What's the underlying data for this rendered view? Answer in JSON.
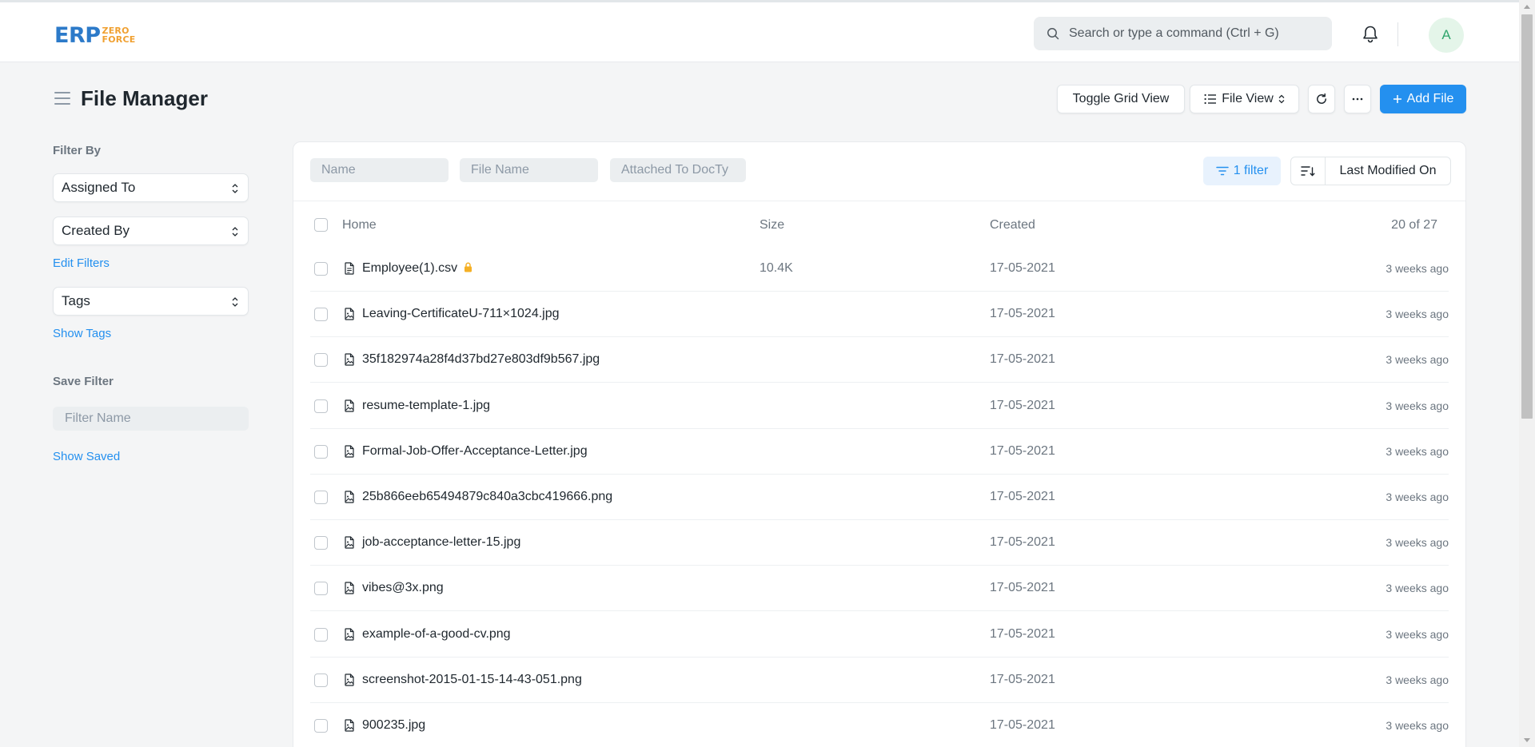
{
  "app": {
    "logo_main": "ERP",
    "logo_top": "ZERO",
    "logo_bottom": "FORCE"
  },
  "navbar": {
    "search_placeholder": "Search or type a command (Ctrl + G)",
    "avatar_initial": "A"
  },
  "page": {
    "title": "File Manager"
  },
  "toolbar": {
    "toggle_grid_label": "Toggle Grid View",
    "file_view_label": "File View",
    "add_file_label": "Add File"
  },
  "sidebar": {
    "filter_by_label": "Filter By",
    "assigned_to_label": "Assigned To",
    "created_by_label": "Created By",
    "edit_filters_label": "Edit Filters",
    "tags_label": "Tags",
    "show_tags_label": "Show Tags",
    "save_filter_label": "Save Filter",
    "filter_name_placeholder": "Filter Name",
    "show_saved_label": "Show Saved"
  },
  "list": {
    "filters": {
      "name_placeholder": "Name",
      "file_name_placeholder": "File Name",
      "attached_to_placeholder": "Attached To DocTy"
    },
    "filter_button_label": "1 filter",
    "sort_label": "Last Modified On",
    "columns": {
      "name": "Home",
      "size": "Size",
      "created": "Created",
      "count": "20 of 27"
    },
    "rows": [
      {
        "name": "Employee(1).csv",
        "size": "10.4K",
        "created": "17-05-2021",
        "modified": "3 weeks ago"
      },
      {
        "name": "Leaving-CertificateU-711×1024.jpg",
        "size": "",
        "created": "17-05-2021",
        "modified": "3 weeks ago"
      },
      {
        "name": "35f182974a28f4d37bd27e803df9b567.jpg",
        "size": "",
        "created": "17-05-2021",
        "modified": "3 weeks ago"
      },
      {
        "name": "resume-template-1.jpg",
        "size": "",
        "created": "17-05-2021",
        "modified": "3 weeks ago"
      },
      {
        "name": "Formal-Job-Offer-Acceptance-Letter.jpg",
        "size": "",
        "created": "17-05-2021",
        "modified": "3 weeks ago"
      },
      {
        "name": "25b866eeb65494879c840a3cbc419666.png",
        "size": "",
        "created": "17-05-2021",
        "modified": "3 weeks ago"
      },
      {
        "name": "job-acceptance-letter-15.jpg",
        "size": "",
        "created": "17-05-2021",
        "modified": "3 weeks ago"
      },
      {
        "name": "vibes@3x.png",
        "size": "",
        "created": "17-05-2021",
        "modified": "3 weeks ago"
      },
      {
        "name": "example-of-a-good-cv.png",
        "size": "",
        "created": "17-05-2021",
        "modified": "3 weeks ago"
      },
      {
        "name": "screenshot-2015-01-15-14-43-051.png",
        "size": "",
        "created": "17-05-2021",
        "modified": "3 weeks ago"
      },
      {
        "name": "900235.jpg",
        "size": "",
        "created": "17-05-2021",
        "modified": "3 weeks ago"
      }
    ]
  },
  "colors": {
    "primary": "#2490ef",
    "logo_blue": "#2c7ac9",
    "logo_orange": "#f0a030",
    "lock_yellow": "#f5b025",
    "avatar_green": "#30a66d"
  }
}
